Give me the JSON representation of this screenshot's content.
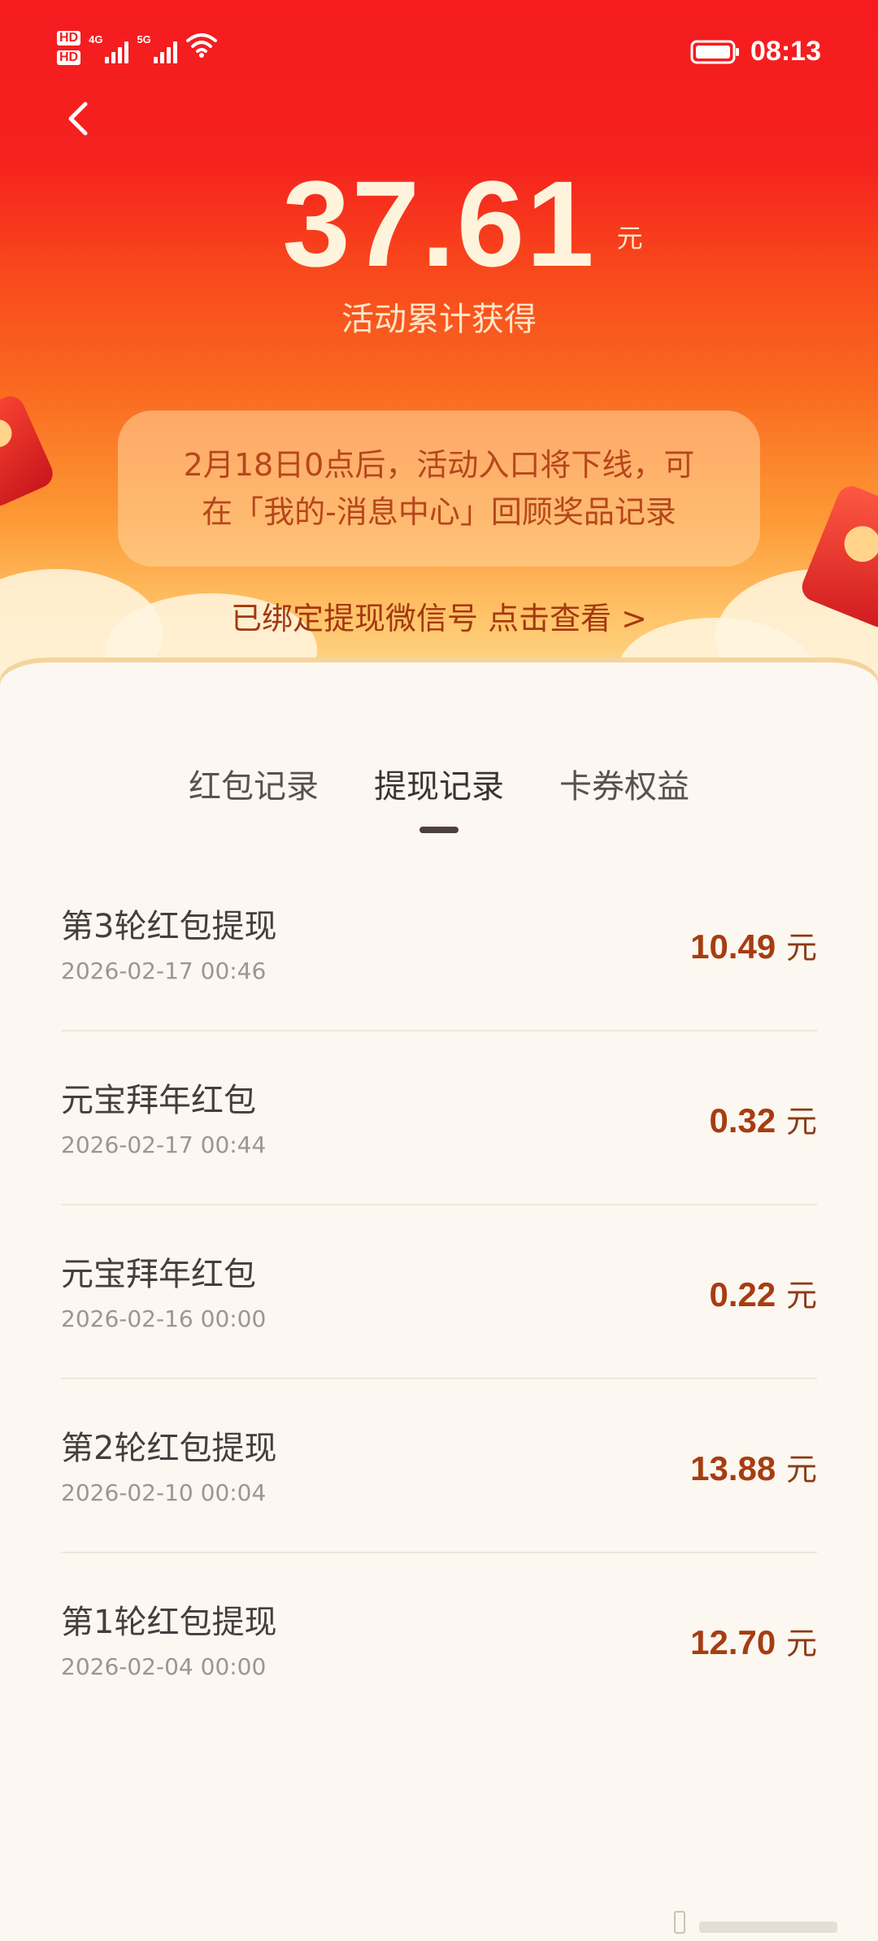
{
  "status_bar": {
    "hd1": "HD",
    "hd2": "HD",
    "net1": "4G",
    "net2": "5G",
    "time": "08:13"
  },
  "summary": {
    "amount": "37.61",
    "unit": "元",
    "caption": "活动累计获得"
  },
  "notice": {
    "line1": "2月18日0点后，活动入口将下线，可",
    "line2": "在「我的-消息中心」回顾奖品记录"
  },
  "bind_link": "已绑定提现微信号 点击查看 >",
  "tabs": [
    {
      "label": "红包记录"
    },
    {
      "label": "提现记录",
      "active": true
    },
    {
      "label": "卡券权益"
    }
  ],
  "records": [
    {
      "title": "第3轮红包提现",
      "date": "2026-02-17 00:46",
      "amount": "10.49",
      "unit": "元"
    },
    {
      "title": "元宝拜年红包",
      "date": "2026-02-17 00:44",
      "amount": "0.32",
      "unit": "元"
    },
    {
      "title": "元宝拜年红包",
      "date": "2026-02-16 00:00",
      "amount": "0.22",
      "unit": "元"
    },
    {
      "title": "第2轮红包提现",
      "date": "2026-02-10 00:04",
      "amount": "13.88",
      "unit": "元"
    },
    {
      "title": "第1轮红包提现",
      "date": "2026-02-04 00:00",
      "amount": "12.70",
      "unit": "元"
    }
  ],
  "colors": {
    "header_red": "#f51b1f",
    "header_gold": "#ffdd93",
    "amount_text": "#a63d12",
    "page_background": "#fcf7f0"
  },
  "icons": {
    "back": "chevron-left-icon",
    "wifi": "wifi-icon",
    "battery": "battery-icon"
  }
}
